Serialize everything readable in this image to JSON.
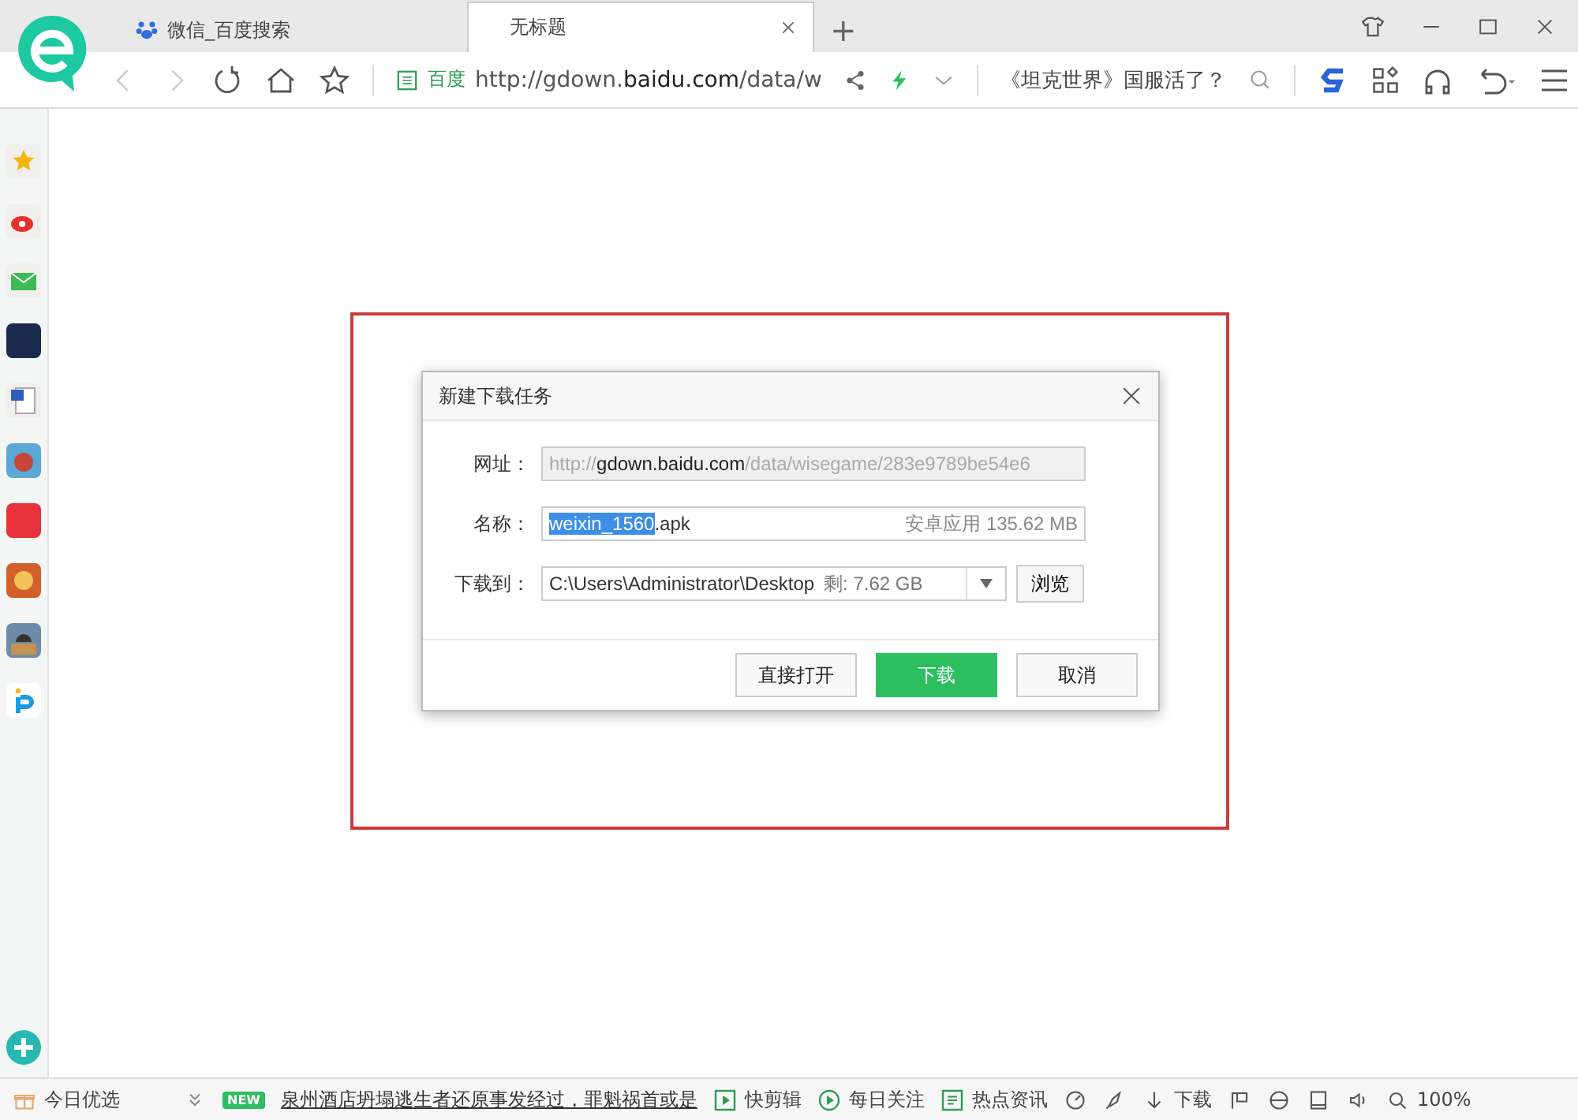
{
  "tabs": [
    {
      "label": "微信_百度搜索",
      "selected": false
    },
    {
      "label": "无标题",
      "selected": true
    }
  ],
  "new_tab": "+",
  "toolbar": {
    "site_label": "百度",
    "address": "http://gdown.**baidu.com**/data/w",
    "search_hint": "《坦克世界》国服活了？"
  },
  "dialog": {
    "title": "新建下载任务",
    "url": {
      "label": "网址：",
      "value": "http://**gdown.baidu.com**/data/wisegame/283e9789be54e6"
    },
    "name": {
      "label": "名称：",
      "selected_text": "weixin_1560",
      "rest_text": ".apk",
      "info": "安卓应用 135.62 MB"
    },
    "save_to": {
      "label": "下载到：",
      "value": "C:\\Users\\Administrator\\Desktop",
      "free": "剩: 7.62 GB",
      "browse": "浏览"
    },
    "buttons": [
      {
        "label": "直接打开",
        "kind": "plain"
      },
      {
        "label": "下载",
        "kind": "primary"
      },
      {
        "label": "取消",
        "kind": "plain"
      }
    ]
  },
  "status_bar": [
    {
      "kind": "icon-text",
      "label": "今日优选"
    },
    {
      "kind": "icon"
    },
    {
      "kind": "badge",
      "label": "NEW"
    },
    {
      "kind": "link",
      "label": "泉州酒店坍塌逃生者还原事发经过，罪魁祸首或是"
    },
    {
      "kind": "icon-text",
      "label": "快剪辑"
    },
    {
      "kind": "icon-text",
      "label": "每日关注"
    },
    {
      "kind": "icon-text",
      "label": "热点资讯"
    },
    {
      "kind": "icon"
    },
    {
      "kind": "icon"
    },
    {
      "kind": "icon-text",
      "label": "下载"
    },
    {
      "kind": "icon"
    },
    {
      "kind": "icon"
    },
    {
      "kind": "icon"
    },
    {
      "kind": "icon"
    },
    {
      "kind": "icon-text",
      "label": "100%"
    }
  ]
}
